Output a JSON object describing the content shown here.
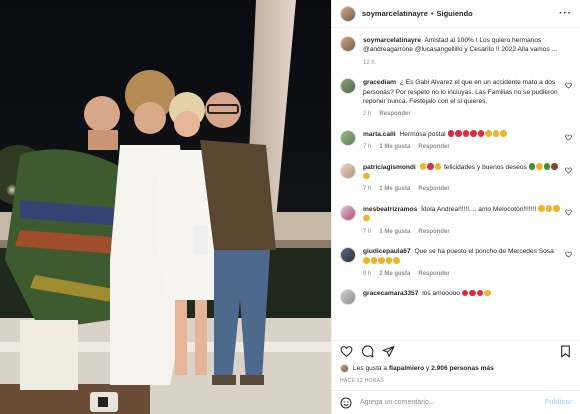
{
  "post": {
    "owner": "soymarcelatinayre",
    "follow_state": "Siguiendo",
    "dot": "•",
    "more": "···"
  },
  "caption": {
    "user": "soymarcelatinayre",
    "text": "Amistad al 100% ! Los quiero hermanos @andreagarrone @lucasangellillo y Cesarito !! 2022 Alla vamos ...",
    "time": "12 h"
  },
  "comments": [
    {
      "user": "gracediam",
      "text": "¿ Es Gabi Alvarez el que en un accidente mato a dos personas? Por respeto no lo incluyas. Las Familias no se pudieron reponer nunca. Festejalo con el si quieres.",
      "time": "2 h",
      "reply": "Responder",
      "likes": ""
    },
    {
      "user": "marta.calli",
      "text": "Hermosa postal",
      "time": "7 h",
      "likes": "1 Me gusta",
      "reply": "Responder"
    },
    {
      "user": "patriciagismondi",
      "text": "felicidades y buenos deseos",
      "time": "7 h",
      "likes": "1 Me gusta",
      "reply": "Responder"
    },
    {
      "user": "inesbeatrizramos",
      "text": "Ídola Andrea!!!!!!.... amo Melocotón!!!!!!!",
      "time": "7 h",
      "likes": "1 Me gusta",
      "reply": "Responder"
    },
    {
      "user": "giudicepaula67",
      "text": "Que se ha puesto el poncho de Mercedes Sosa",
      "time": "9 h",
      "likes": "2 Me gusta",
      "reply": "Responder"
    },
    {
      "user": "gracecamara3357",
      "text": "los amooooo",
      "time": "",
      "likes": "",
      "reply": ""
    }
  ],
  "likes_line": {
    "prefix": "Les gusta a",
    "user": "flapalmiero",
    "mid": "y",
    "count": "2.906 personas más"
  },
  "time_ago": "HACE 12 HORAS",
  "add_comment": {
    "placeholder": "Agrega un comentario...",
    "publish": "Publicar"
  },
  "icons": {
    "heart": "heart-icon",
    "comment": "comment-icon",
    "share": "share-icon",
    "save": "bookmark-icon",
    "smile": "emoji-icon"
  },
  "colors": {
    "accent_red": "#ed4956",
    "muted": "#8e8e8e",
    "publish": "#b2dffc"
  }
}
